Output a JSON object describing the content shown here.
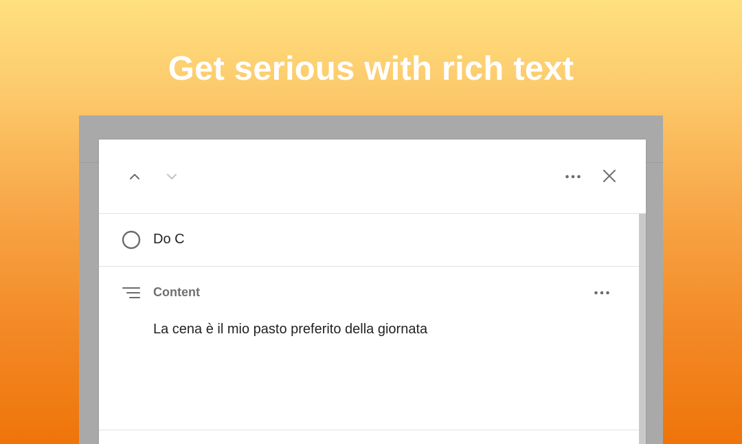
{
  "headline": "Get serious with rich text",
  "toolbar": {
    "icons": [
      "chevron-up-icon",
      "chevron-down-icon",
      "more-horizontal-icon",
      "close-icon"
    ]
  },
  "task": {
    "title": "Do C",
    "status_icon": "circle-checkbox-icon"
  },
  "content": {
    "label": "Content",
    "icon": "text-align-icon",
    "text": "La cena è il mio pasto preferito della giornata"
  },
  "colors": {
    "gradient_top": "#ffe07f",
    "gradient_bottom": "#ef740a",
    "backdrop": "#a9a9a9",
    "icon_dark": "#6b6b6b",
    "icon_disabled": "#c2c2c2",
    "label_gray": "#707070",
    "text": "#222222"
  }
}
